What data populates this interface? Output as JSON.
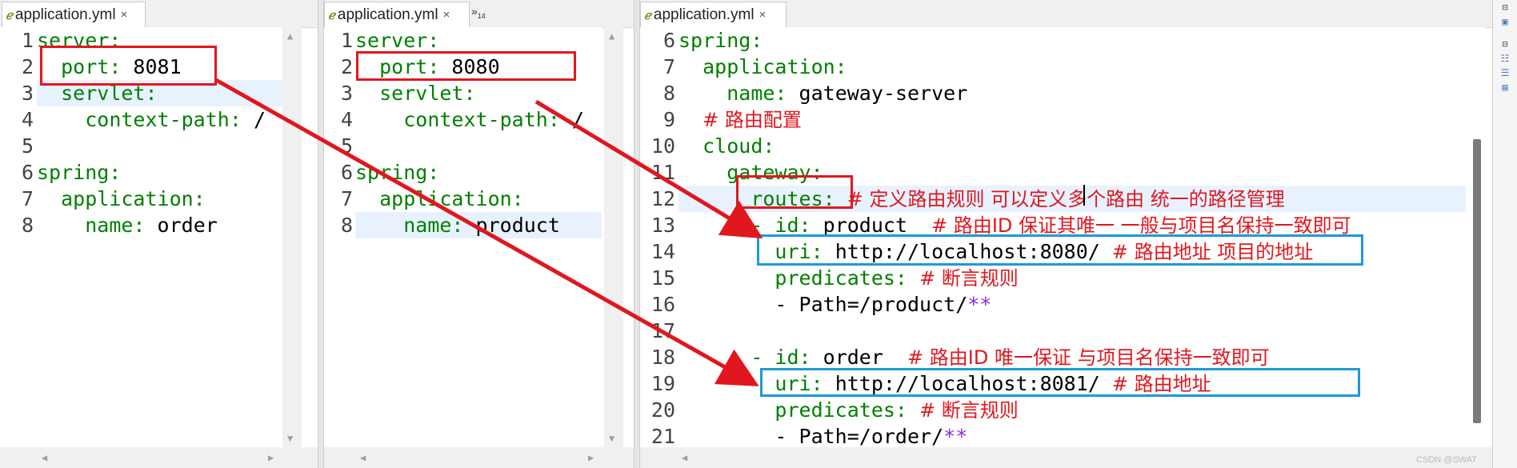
{
  "panes": [
    {
      "tab": {
        "label": "application.yml",
        "close": "×"
      },
      "lines": [
        {
          "n": "1",
          "t": "server:"
        },
        {
          "n": "2",
          "t": "port: 8081"
        },
        {
          "n": "3",
          "t": "servlet:"
        },
        {
          "n": "4",
          "t": "context-path: /"
        },
        {
          "n": "5",
          "t": ""
        },
        {
          "n": "6",
          "t": "spring:"
        },
        {
          "n": "7",
          "t": "application:"
        },
        {
          "n": "8",
          "t": "name: order"
        }
      ]
    },
    {
      "tab": {
        "label": "application.yml",
        "close": "×"
      },
      "overflow": {
        "symbol": "»",
        "count": "14"
      },
      "lines": [
        {
          "n": "1",
          "t": "server:"
        },
        {
          "n": "2",
          "t": "port: 8080"
        },
        {
          "n": "3",
          "t": "servlet:"
        },
        {
          "n": "4",
          "t": "context-path: /"
        },
        {
          "n": "5",
          "t": ""
        },
        {
          "n": "6",
          "t": "spring:"
        },
        {
          "n": "7",
          "t": "application:"
        },
        {
          "n": "8",
          "t": "name: product"
        }
      ]
    },
    {
      "tab": {
        "label": "application.yml",
        "close": "×"
      },
      "lines": [
        {
          "n": "6",
          "key": "spring:",
          "val": "",
          "comment": ""
        },
        {
          "n": "7",
          "key": "application:",
          "val": "",
          "comment": ""
        },
        {
          "n": "8",
          "key": "name:",
          "val": "gateway-server",
          "comment": ""
        },
        {
          "n": "9",
          "key": "",
          "val": "",
          "comment": "# 路由配置"
        },
        {
          "n": "10",
          "key": "cloud:",
          "val": "",
          "comment": ""
        },
        {
          "n": "11",
          "key": "gateway:",
          "val": "",
          "comment": ""
        },
        {
          "n": "12",
          "key": "routes:",
          "val": "",
          "comment": "# 定义路由规则 可以定义多个路由 统一的路径管理"
        },
        {
          "n": "13",
          "key": "- id:",
          "val": "product",
          "comment": "# 路由ID 保证其唯一 一般与项目名保持一致即可"
        },
        {
          "n": "14",
          "key": "uri:",
          "val": "http://localhost:8080/",
          "comment": "# 路由地址 项目的地址"
        },
        {
          "n": "15",
          "key": "predicates:",
          "val": "",
          "comment": "# 断言规则"
        },
        {
          "n": "16",
          "key": "",
          "val": "- Path=/product/",
          "stars": "**",
          "comment": ""
        },
        {
          "n": "17",
          "key": "",
          "val": "",
          "comment": ""
        },
        {
          "n": "18",
          "key": "- id:",
          "val": "order",
          "comment": "# 路由ID 唯一保证 与项目名保持一致即可"
        },
        {
          "n": "19",
          "key": "uri:",
          "val": "http://localhost:8081/",
          "comment": "# 路由地址"
        },
        {
          "n": "20",
          "key": "predicates:",
          "val": "",
          "comment": "# 断言规则"
        },
        {
          "n": "21",
          "key": "",
          "val": "- Path=/order/",
          "stars": "**",
          "comment": ""
        }
      ]
    }
  ],
  "colors": {
    "key": "#008000",
    "comment": "#e0171f",
    "annotation_red": "#e0171f",
    "annotation_blue": "#1e9ad6"
  },
  "watermark": "CSDN @SWAT"
}
